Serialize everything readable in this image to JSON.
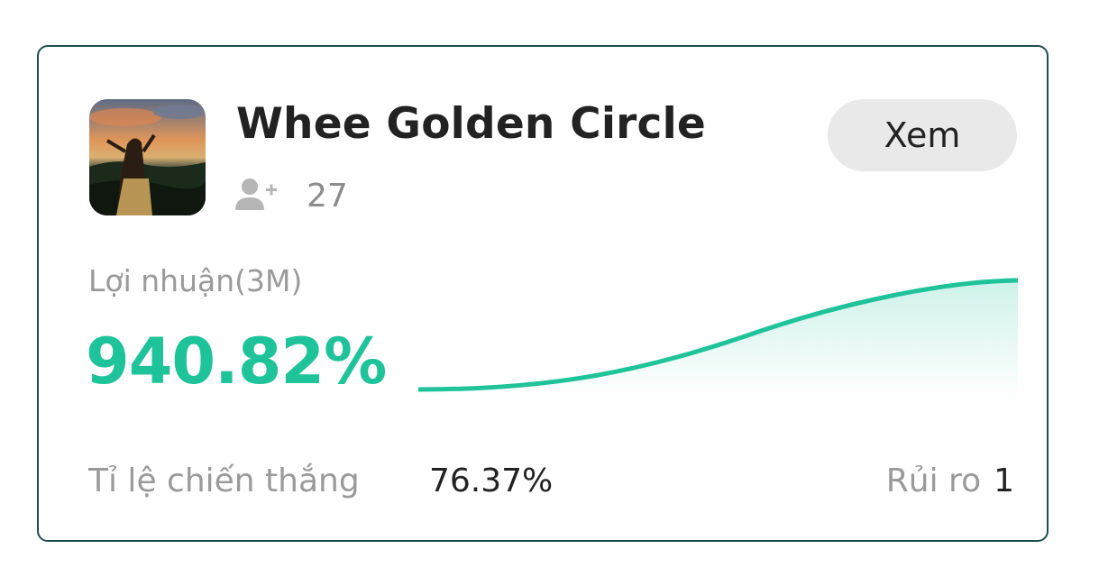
{
  "card": {
    "title": "Whee Golden Circle",
    "followers": {
      "icon": "add-user-icon",
      "count": "27"
    },
    "view_button": "Xem",
    "avatar": "sunset-photo-avatar"
  },
  "profit": {
    "label": "Lợi nhuận(3M)",
    "value": "940.82%"
  },
  "stats": {
    "win_rate_label": "Tỉ lệ chiến thắng",
    "win_rate_value": "76.37%",
    "risk_label": "Rủi ro",
    "risk_value": "1"
  },
  "colors": {
    "accent": "#1fc39a",
    "border": "#1f4e4f",
    "button_bg": "#e9e9e9",
    "muted_text": "#9a9a9a",
    "primary_text": "#222222"
  }
}
